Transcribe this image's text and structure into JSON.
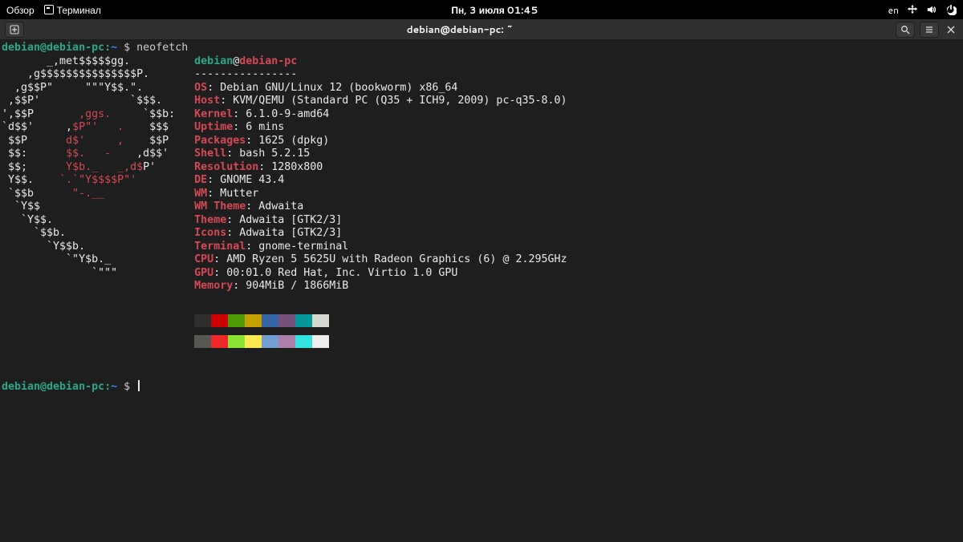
{
  "panel": {
    "overview": "Обзор",
    "terminal_label": "Терминал",
    "clock": "Пн, 3 июля  01:45",
    "lang": "en"
  },
  "headerbar": {
    "title": "debian@debian-pc: ~"
  },
  "prompt": {
    "user_host": "debian@debian-pc",
    "colon": ":",
    "path": "~",
    "dollar": "$",
    "command": "neofetch"
  },
  "ascii": {
    "lines": [
      "       _,met$$$$$gg.         ",
      "    ,g$$$$$$$$$$$$$$$P.      ",
      "  ,g$$P\"     \"\"\"Y$$.\".      ",
      " ,$$P'              `$$$.    ",
      "',$$P       ,ggs.     `$$b:  ",
      "`d$$'     ,$P\"'   .    $$$   ",
      " $$P      d$'     ,    $$P   ",
      " $$:      $$.   -    ,d$$'   ",
      " $$;      Y$b._   _,d$P'     ",
      " Y$$.    `.`\"Y$$$$P\"'        ",
      " `$$b      \"-.__             ",
      "  `Y$$                        ",
      "   `Y$$.                      ",
      "     `$$b.                    ",
      "       `Y$$b.                 ",
      "          `\"Y$b._             ",
      "              `\"\"\"            "
    ],
    "dot_positions": {
      "4": 20,
      "5": 22,
      "6": 18,
      "7": 20,
      "8": 0,
      "9": 9,
      "10": 11
    }
  },
  "neofetch": {
    "title_user": "debian",
    "title_at": "@",
    "title_host": "debian-pc",
    "dashes": "----------------",
    "rows": [
      {
        "k": "OS",
        "v": "Debian GNU/Linux 12 (bookworm) x86_64"
      },
      {
        "k": "Host",
        "v": "KVM/QEMU (Standard PC (Q35 + ICH9, 2009) pc-q35-8.0)"
      },
      {
        "k": "Kernel",
        "v": "6.1.0-9-amd64"
      },
      {
        "k": "Uptime",
        "v": "6 mins"
      },
      {
        "k": "Packages",
        "v": "1625 (dpkg)"
      },
      {
        "k": "Shell",
        "v": "bash 5.2.15"
      },
      {
        "k": "Resolution",
        "v": "1280x800"
      },
      {
        "k": "DE",
        "v": "GNOME 43.4"
      },
      {
        "k": "WM",
        "v": "Mutter"
      },
      {
        "k": "WM Theme",
        "v": "Adwaita"
      },
      {
        "k": "Theme",
        "v": "Adwaita [GTK2/3]"
      },
      {
        "k": "Icons",
        "v": "Adwaita [GTK2/3]"
      },
      {
        "k": "Terminal",
        "v": "gnome-terminal"
      },
      {
        "k": "CPU",
        "v": "AMD Ryzen 5 5625U with Radeon Graphics (6) @ 2.295GHz"
      },
      {
        "k": "GPU",
        "v": "00:01.0 Red Hat, Inc. Virtio 1.0 GPU"
      },
      {
        "k": "Memory",
        "v": "904MiB / 1866MiB"
      }
    ]
  },
  "swatches": {
    "row1": [
      "#2e2e2e",
      "#cc0000",
      "#4e9a06",
      "#c4a000",
      "#3465a4",
      "#75507b",
      "#06989a",
      "#d3d7cf"
    ],
    "row2": [
      "#555753",
      "#ef2929",
      "#8ae234",
      "#fce94f",
      "#729fcf",
      "#ad7fa8",
      "#34e2e2",
      "#eeeeec"
    ]
  }
}
